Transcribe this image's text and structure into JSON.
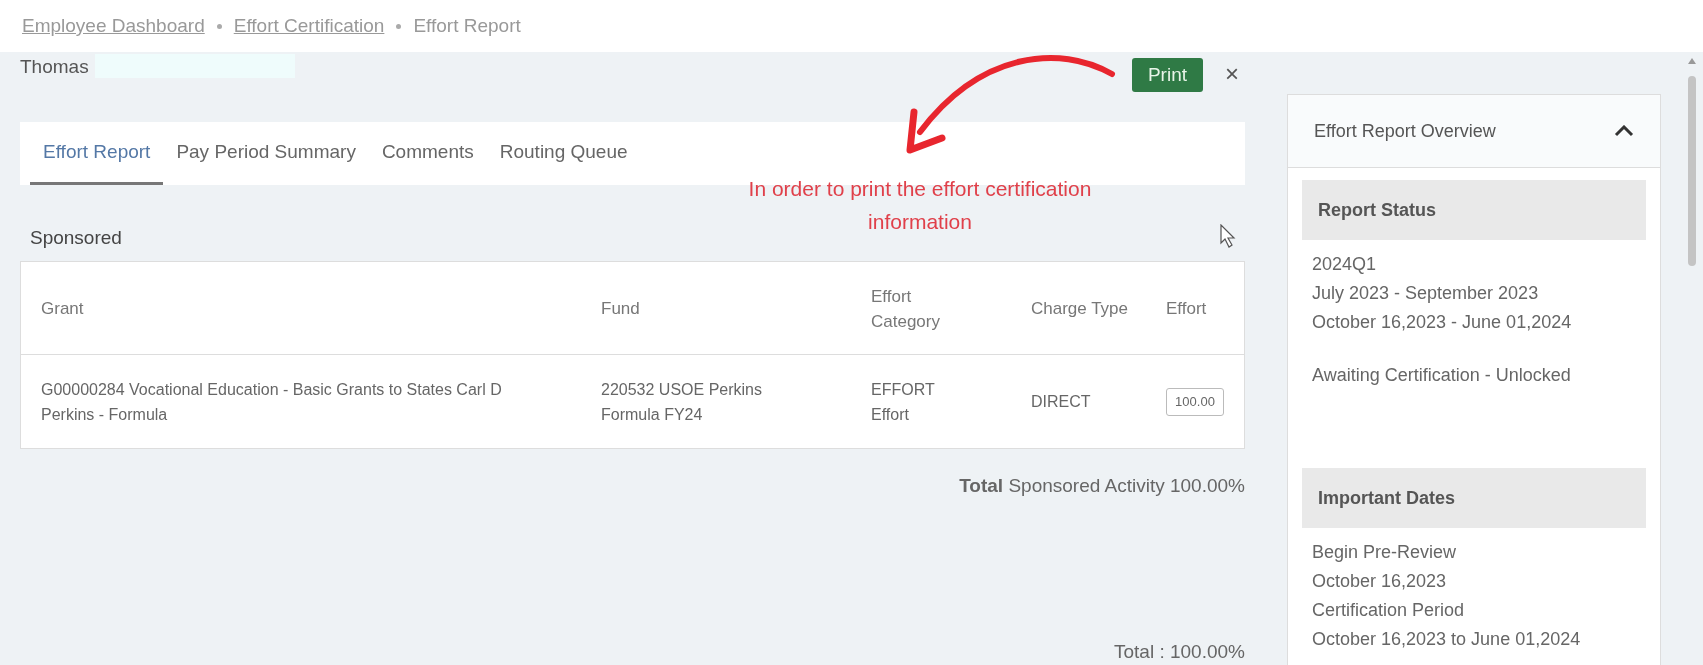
{
  "breadcrumb": [
    {
      "label": "Employee Dashboard",
      "kind": "link"
    },
    {
      "label": "Effort Certification",
      "kind": "link"
    },
    {
      "label": "Effort Report",
      "kind": "current"
    }
  ],
  "employee": {
    "name": "Thomas"
  },
  "print_button": "Print",
  "close_button": "×",
  "annotation": {
    "text": "In order to print the effort certification information"
  },
  "tabs": [
    {
      "label": "Effort Report",
      "selected": true
    },
    {
      "label": "Pay Period Summary",
      "selected": false
    },
    {
      "label": "Comments",
      "selected": false
    },
    {
      "label": "Routing Queue",
      "selected": false
    }
  ],
  "section_title": "Sponsored",
  "table": {
    "columns": [
      "Grant",
      "Fund",
      "Effort Category",
      "Charge Type",
      "Effort"
    ],
    "rows": [
      {
        "grant": "G00000284 Vocational Education - Basic Grants to States Carl D Perkins - Formula",
        "fund": "220532 USOE Perkins Formula FY24",
        "category": "EFFORT Effort",
        "charge_type": "DIRECT",
        "effort": "100.00"
      }
    ]
  },
  "sponsored_total": "**Total** Sponsored Activity 100.00%",
  "grand_total": "Total : 100.00%",
  "overview": {
    "title": "Effort Report Overview",
    "expanded": true,
    "sections": [
      {
        "title": "Report Status",
        "lines": [
          "2024Q1",
          "July 2023 - September 2023",
          "October 16,2023 - June 01,2024"
        ],
        "status": "Awaiting Certification - Unlocked"
      },
      {
        "title": "Important Dates",
        "lines": [
          "Begin Pre-Review",
          "October 16,2023",
          "Certification Period",
          "October 16,2023 to June 01,2024"
        ]
      }
    ]
  }
}
